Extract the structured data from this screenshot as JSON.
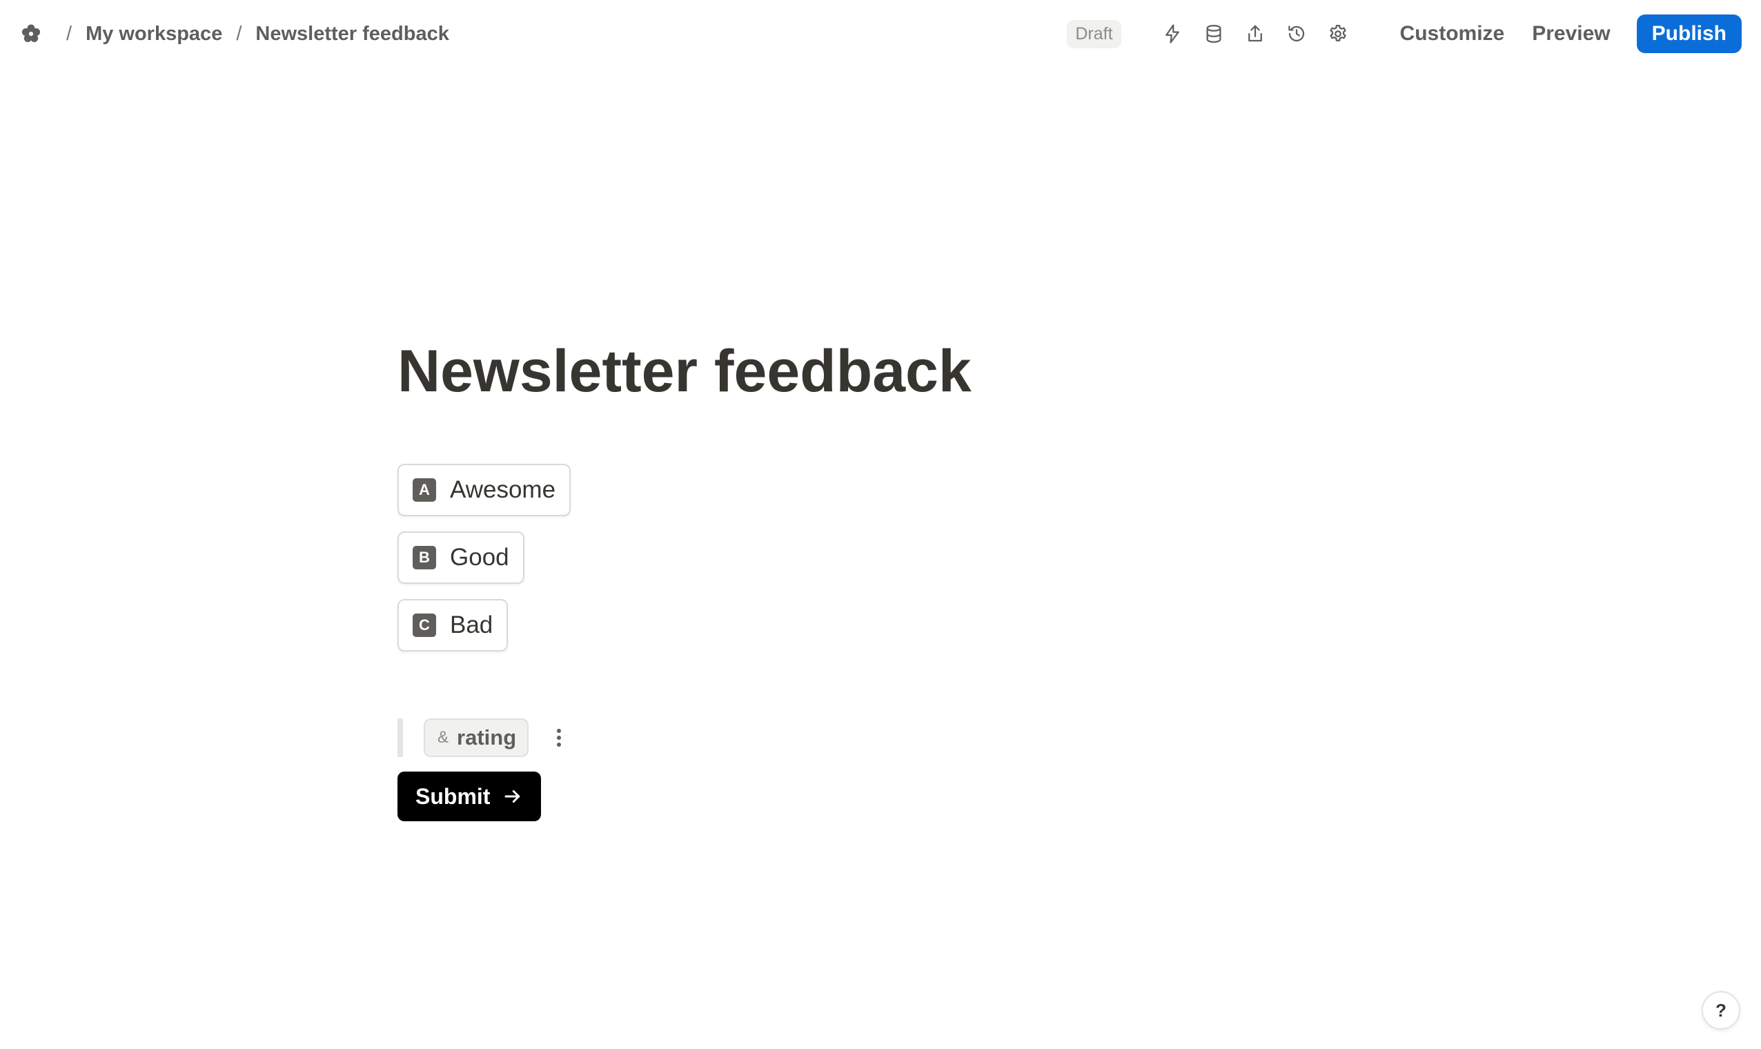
{
  "header": {
    "logo_icon": "flower-logo-icon",
    "breadcrumb": {
      "separator": "/",
      "workspace": "My workspace",
      "form": "Newsletter feedback"
    },
    "status_badge": "Draft",
    "icons": [
      "lightning-icon",
      "database-icon",
      "share-icon",
      "history-icon",
      "settings-icon"
    ],
    "customize_label": "Customize",
    "preview_label": "Preview",
    "publish_label": "Publish",
    "accent_color": "#0b6ed8"
  },
  "form": {
    "title": "Newsletter feedback",
    "options": [
      {
        "key": "A",
        "label": "Awesome"
      },
      {
        "key": "B",
        "label": "Good"
      },
      {
        "key": "C",
        "label": "Bad"
      }
    ],
    "field": {
      "symbol": "&",
      "name": "rating"
    },
    "submit_label": "Submit"
  },
  "help": {
    "label": "?"
  }
}
